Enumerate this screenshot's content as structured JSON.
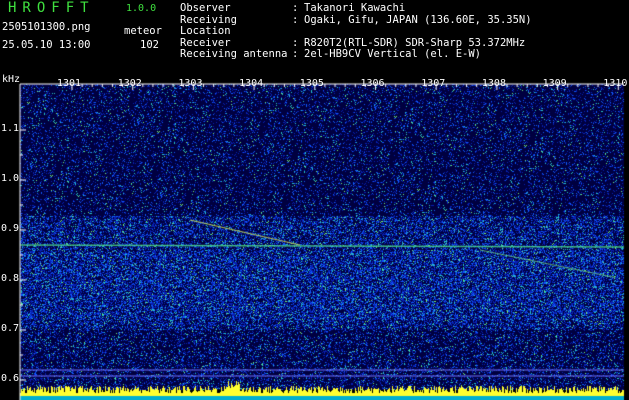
{
  "header": {
    "app_title": "HROFFT",
    "app_version": "1.0.0",
    "filename": "2505101300.png",
    "datetime": "25.05.10 13:00",
    "meteor_label": "meteor",
    "meteor_count": "102",
    "info": [
      {
        "key": "Observer",
        "sep": ":",
        "value": "Takanori Kawachi"
      },
      {
        "key": "Receiving Location",
        "sep": ":",
        "value": "Ogaki, Gifu, JAPAN (136.60E, 35.35N)"
      },
      {
        "key": "Receiver",
        "sep": ":",
        "value": "R820T2(RTL-SDR) SDR-Sharp 53.372MHz"
      },
      {
        "key": "Receiving antenna",
        "sep": ":",
        "value": "2el-HB9CV Vertical (el. E-W)"
      }
    ]
  },
  "chart_data": {
    "type": "heatmap",
    "ylabel": "kHz",
    "x_ticks": [
      "1301",
      "1302",
      "1303",
      "1304",
      "1305",
      "1306",
      "1307",
      "1308",
      "1309",
      "1310"
    ],
    "y_ticks": [
      "1.1",
      "1.0",
      "0.9",
      "0.8",
      "0.7",
      "0.6"
    ],
    "ylim": [
      0.6,
      1.15
    ],
    "carrier_khz": 0.87,
    "colors": {
      "background": "#000040",
      "noise_low": "#0820c0",
      "noise_mid": "#1060ff",
      "noise_high": "#40e0a0",
      "hot": "#ffff40",
      "axis": "#ffffff",
      "grid": "#7070ff"
    }
  }
}
